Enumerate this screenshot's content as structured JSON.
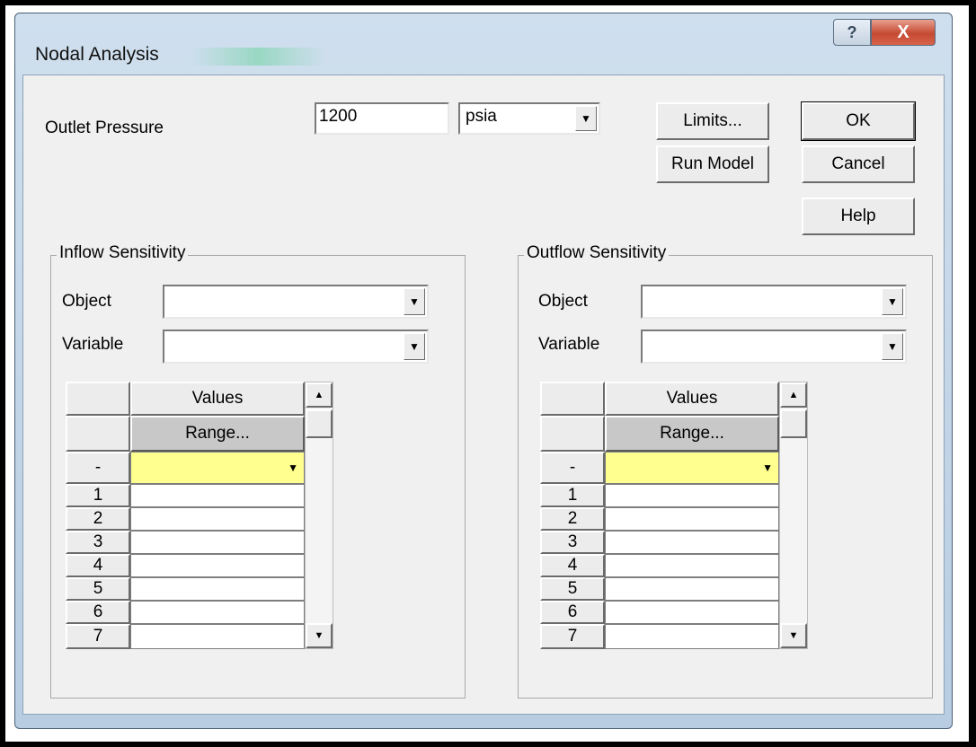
{
  "window": {
    "title": "Nodal Analysis"
  },
  "outlet": {
    "label": "Outlet Pressure",
    "value": "1200",
    "unit": "psia"
  },
  "buttons": {
    "limits": "Limits...",
    "ok": "OK",
    "run_model": "Run Model",
    "cancel": "Cancel",
    "help": "Help"
  },
  "inflow": {
    "title": "Inflow Sensitivity",
    "object_label": "Object",
    "object_value": "",
    "variable_label": "Variable",
    "variable_value": "",
    "grid": {
      "header": "Values",
      "range": "Range...",
      "input_row_label": "-",
      "rows": [
        "1",
        "2",
        "3",
        "4",
        "5",
        "6",
        "7"
      ]
    }
  },
  "outflow": {
    "title": "Outflow Sensitivity",
    "object_label": "Object",
    "object_value": "",
    "variable_label": "Variable",
    "variable_value": "",
    "grid": {
      "header": "Values",
      "range": "Range...",
      "input_row_label": "-",
      "rows": [
        "1",
        "2",
        "3",
        "4",
        "5",
        "6",
        "7"
      ]
    }
  },
  "icons": {
    "help": "?",
    "close": "X",
    "dropdown": "▼",
    "scroll_up": "▲",
    "scroll_down": "▼"
  }
}
